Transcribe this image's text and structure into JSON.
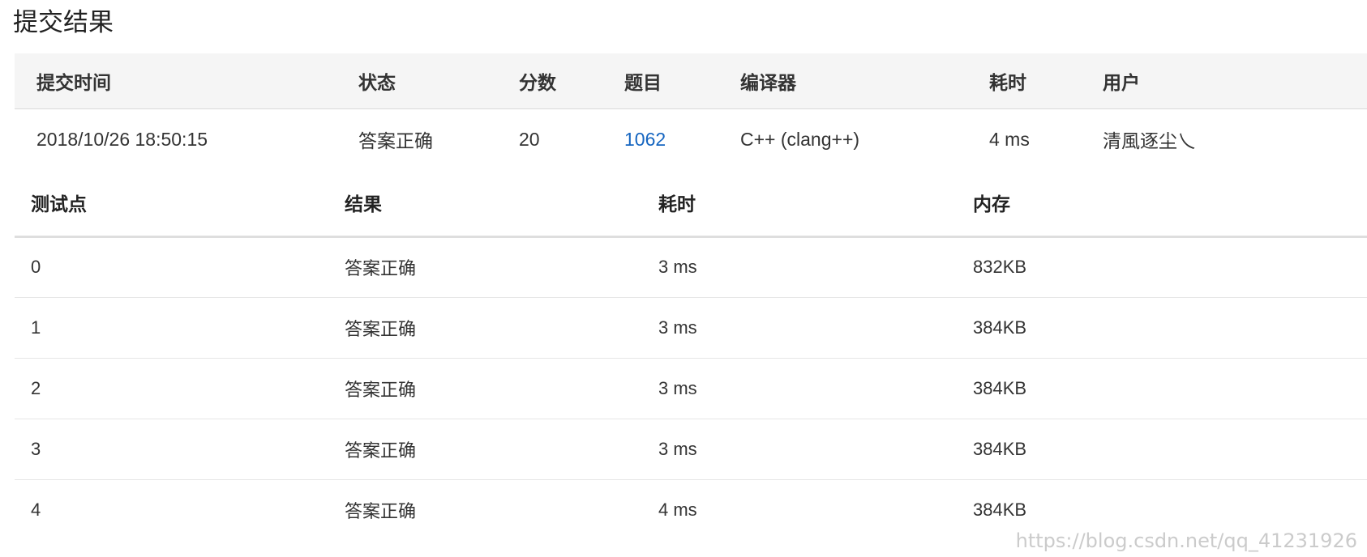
{
  "page": {
    "title": "提交结果"
  },
  "submission": {
    "headers": {
      "time": "提交时间",
      "status": "状态",
      "score": "分数",
      "problem": "题目",
      "compiler": "编译器",
      "elapsed": "耗时",
      "user": "用户"
    },
    "row": {
      "time": "2018/10/26 18:50:15",
      "status": "答案正确",
      "score": "20",
      "problem": "1062",
      "compiler": "C++ (clang++)",
      "elapsed": "4 ms",
      "user": "清風逐尘乀"
    }
  },
  "cases": {
    "headers": {
      "id": "测试点",
      "result": "结果",
      "elapsed": "耗时",
      "memory": "内存"
    },
    "rows": [
      {
        "id": "0",
        "result": "答案正确",
        "elapsed": "3 ms",
        "memory": "832KB"
      },
      {
        "id": "1",
        "result": "答案正确",
        "elapsed": "3 ms",
        "memory": "384KB"
      },
      {
        "id": "2",
        "result": "答案正确",
        "elapsed": "3 ms",
        "memory": "384KB"
      },
      {
        "id": "3",
        "result": "答案正确",
        "elapsed": "3 ms",
        "memory": "384KB"
      },
      {
        "id": "4",
        "result": "答案正确",
        "elapsed": "4 ms",
        "memory": "384KB"
      }
    ]
  },
  "watermark": "https://blog.csdn.net/qq_41231926",
  "colors": {
    "success": "#e53935",
    "link": "#1565c0",
    "header_bg": "#f5f5f5"
  }
}
